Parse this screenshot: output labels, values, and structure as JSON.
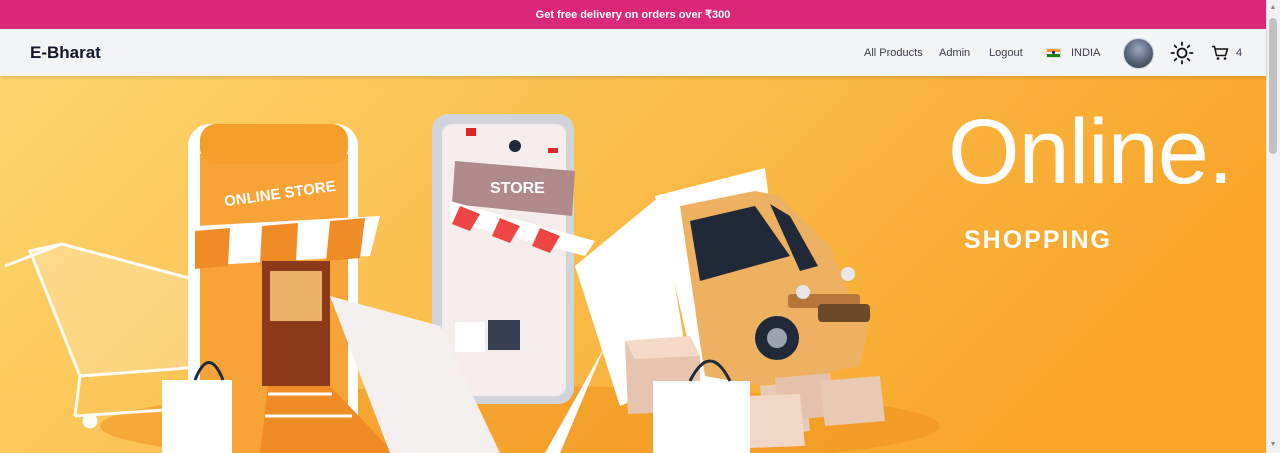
{
  "promo_banner": {
    "text": "Get free delivery on orders over ₹300"
  },
  "header": {
    "brand": "E-Bharat",
    "nav_links": [
      "All Products",
      "Admin",
      "Logout"
    ],
    "country": "INDIA",
    "cart_count": "4"
  },
  "hero": {
    "headline": "Online.",
    "subheadline": "SHOPPING",
    "store_sign": "ONLINE STORE",
    "phone_sign": "STORE"
  },
  "colors": {
    "promo_bg": "#db2777",
    "nav_bg": "#f3f4f6",
    "hero_gradient_start": "#fdd66e",
    "hero_gradient_end": "#f8a52a",
    "text_white": "#ffffff"
  },
  "icons": [
    "india-flag-icon",
    "sun-icon",
    "cart-icon"
  ]
}
